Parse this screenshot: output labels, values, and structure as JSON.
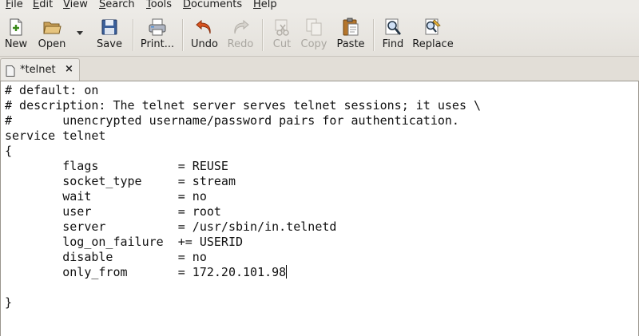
{
  "menubar": {
    "items": [
      {
        "label": "File",
        "mnemonic": "F",
        "rest": "ile"
      },
      {
        "label": "Edit",
        "mnemonic": "E",
        "rest": "dit"
      },
      {
        "label": "View",
        "mnemonic": "V",
        "rest": "iew"
      },
      {
        "label": "Search",
        "mnemonic": "S",
        "rest": "earch"
      },
      {
        "label": "Tools",
        "mnemonic": "T",
        "rest": "ools"
      },
      {
        "label": "Documents",
        "mnemonic": "D",
        "rest": "ocuments"
      },
      {
        "label": "Help",
        "mnemonic": "H",
        "rest": "elp"
      }
    ]
  },
  "toolbar": {
    "new_label": "New",
    "open_label": "Open",
    "save_label": "Save",
    "print_label": "Print...",
    "undo_label": "Undo",
    "redo_label": "Redo",
    "cut_label": "Cut",
    "copy_label": "Copy",
    "paste_label": "Paste",
    "find_label": "Find",
    "replace_label": "Replace",
    "disabled": [
      "redo",
      "cut",
      "copy"
    ]
  },
  "tab": {
    "title": "*telnet",
    "close_glyph": "×"
  },
  "editor": {
    "lines": [
      "# default: on",
      "# description: The telnet server serves telnet sessions; it uses \\",
      "#       unencrypted username/password pairs for authentication.",
      "service telnet",
      "{",
      "        flags           = REUSE",
      "        socket_type     = stream",
      "        wait            = no",
      "        user            = root",
      "        server          = /usr/sbin/in.telnetd",
      "        log_on_failure  += USERID",
      "        disable         = no",
      "        only_from       = 172.20.101.98",
      "",
      "}"
    ],
    "caret_line": 12
  },
  "colors": {
    "chrome": "#edebe7",
    "editor_bg": "#ffffff",
    "text": "#111111",
    "disabled_text": "#a9a6a0"
  }
}
